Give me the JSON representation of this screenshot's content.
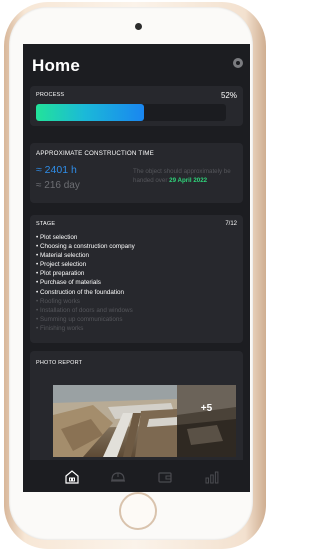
{
  "screen": {
    "title": "Home"
  },
  "process": {
    "label": "PROCESS",
    "percent_text": "52%",
    "progress_fraction": 0.57
  },
  "construction_time": {
    "label": "APPROXIMATE CONSTRUCTION TIME",
    "hours": "≈ 2401 h",
    "days": "≈ 216 day",
    "handover_prefix": "The object should approximately be handed over",
    "handover_date": "29 April 2022"
  },
  "stage": {
    "label": "STAGE",
    "count": "7/12",
    "items_done": [
      "Plot selection",
      "Choosing a construction company",
      "Material selection",
      "Project selection",
      "Plot preparation",
      "Purchase of materials",
      "Construction of the foundation"
    ],
    "items_pending": [
      "Roofing works",
      "Installation of doors and windows",
      "Summing up communications",
      "Finishing works"
    ]
  },
  "photo_report": {
    "label": "PHOTO REPORT",
    "more_count": "+5"
  },
  "nav": {
    "items": [
      "home-icon",
      "helmet-icon",
      "wallet-icon",
      "stats-icon"
    ],
    "active_color": "#ffffff",
    "inactive_color": "#4a4b50"
  },
  "colors": {
    "accent_blue": "#2f8de8",
    "accent_green": "#2fd47a",
    "screen_bg": "#1c1d21",
    "card_bg": "#27282d"
  }
}
